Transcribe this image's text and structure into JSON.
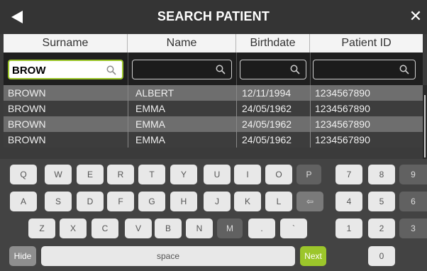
{
  "header": {
    "title": "SEARCH PATIENT"
  },
  "table": {
    "columns": [
      "Surname",
      "Name",
      "Birthdate",
      "Patient ID"
    ],
    "filters": [
      "BROW",
      "",
      "",
      ""
    ],
    "rows": [
      [
        "BROWN",
        "ALBERT",
        "12/11/1994",
        "1234567890"
      ],
      [
        "BROWN",
        "EMMA",
        "24/05/1962",
        "1234567890"
      ],
      [
        "BROWN",
        "EMMA",
        "24/05/1962",
        "1234567890"
      ],
      [
        "BROWN",
        "EMMA",
        "24/05/1962",
        "1234567890"
      ]
    ]
  },
  "keyboard": {
    "row1": [
      "Q",
      "W",
      "E",
      "R",
      "T",
      "Y",
      "U",
      "I",
      "O",
      "P"
    ],
    "row2": [
      "A",
      "S",
      "D",
      "F",
      "G",
      "H",
      "J",
      "K",
      "L",
      "⇦"
    ],
    "row3": [
      "Z",
      "X",
      "C",
      "V",
      "B",
      "N",
      "M",
      ".",
      "`"
    ],
    "numpad": [
      "7",
      "8",
      "9",
      "4",
      "5",
      "6",
      "1",
      "2",
      "3",
      "0"
    ],
    "hide_label": "Hide",
    "space_label": "space",
    "next_label": "Next"
  },
  "colors": {
    "accent": "#9cc62b",
    "header_bg": "#343434",
    "keyboard_bg": "#434343"
  },
  "icons": {
    "back": "back-arrow-icon",
    "close": "close-icon",
    "search": "search-icon"
  }
}
